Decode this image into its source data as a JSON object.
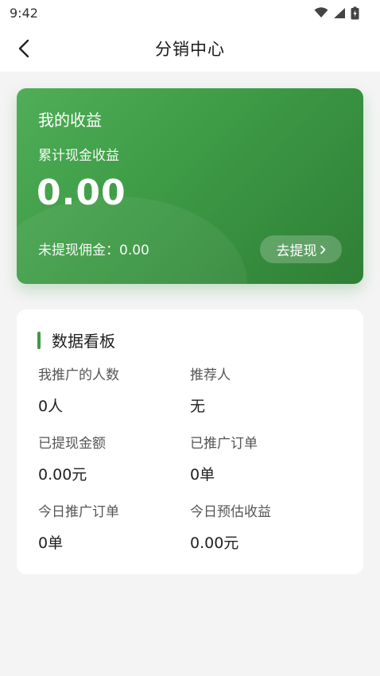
{
  "status_bar": {
    "time": "9:42"
  },
  "header": {
    "title": "分销中心"
  },
  "earnings": {
    "title": "我的收益",
    "subtitle": "累计现金收益",
    "amount": "0.00",
    "pending": "未提现佣金：0.00",
    "withdraw_label": "去提现",
    "accent": "#3d9a45"
  },
  "dashboard": {
    "title": "数据看板",
    "stats": [
      {
        "label": "我推广的人数",
        "value": "0人"
      },
      {
        "label": "推荐人",
        "value": "无"
      },
      {
        "label": "已提现金额",
        "value": "0.00元"
      },
      {
        "label": "已推广订单",
        "value": "0单"
      },
      {
        "label": "今日推广订单",
        "value": "0单"
      },
      {
        "label": "今日预估收益",
        "value": "0.00元"
      }
    ]
  }
}
